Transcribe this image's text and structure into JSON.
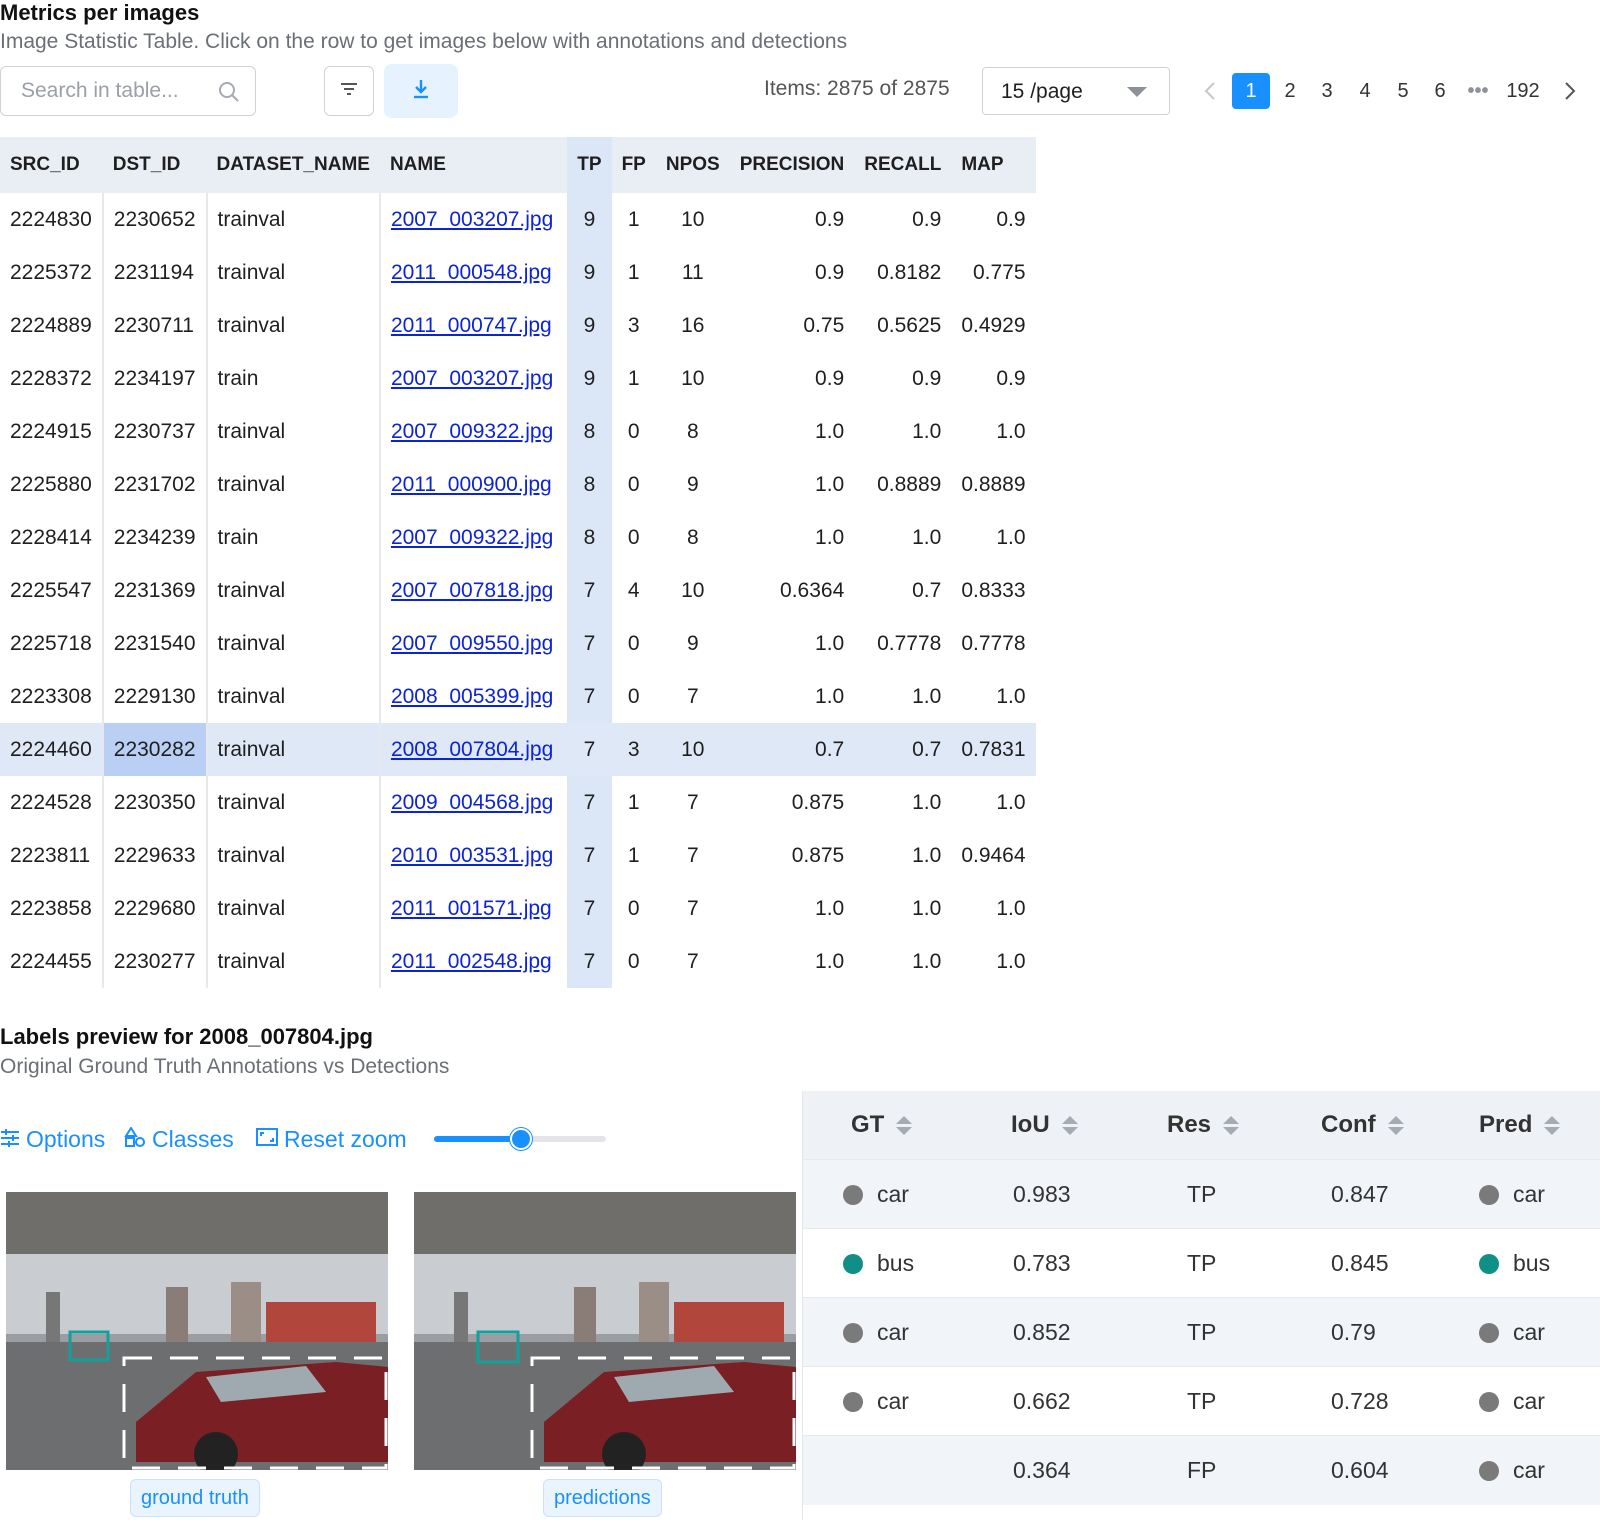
{
  "header": {
    "title": "Metrics per images",
    "subtitle": "Image Statistic Table. Click on the row to get images below with annotations and detections"
  },
  "toolbar": {
    "search_placeholder": "Search in table...",
    "items_text": "Items: 2875 of 2875",
    "page_size": "15 /page",
    "icons": [
      "search-icon",
      "filter-icon",
      "download-icon"
    ]
  },
  "pagination": {
    "pages": [
      "1",
      "2",
      "3",
      "4",
      "5",
      "6"
    ],
    "ellipsis": "•••",
    "last": "192",
    "active": "1"
  },
  "table": {
    "columns": [
      "SRC_ID",
      "DST_ID",
      "DATASET_NAME",
      "NAME",
      "TP",
      "FP",
      "NPOS",
      "PRECISION",
      "RECALL",
      "MAP"
    ],
    "selected_row": 10,
    "rows": [
      [
        "2224830",
        "2230652",
        "trainval",
        "2007_003207.jpg",
        "9",
        "1",
        "10",
        "0.9",
        "0.9",
        "0.9"
      ],
      [
        "2225372",
        "2231194",
        "trainval",
        "2011_000548.jpg",
        "9",
        "1",
        "11",
        "0.9",
        "0.8182",
        "0.775"
      ],
      [
        "2224889",
        "2230711",
        "trainval",
        "2011_000747.jpg",
        "9",
        "3",
        "16",
        "0.75",
        "0.5625",
        "0.4929"
      ],
      [
        "2228372",
        "2234197",
        "train",
        "2007_003207.jpg",
        "9",
        "1",
        "10",
        "0.9",
        "0.9",
        "0.9"
      ],
      [
        "2224915",
        "2230737",
        "trainval",
        "2007_009322.jpg",
        "8",
        "0",
        "8",
        "1.0",
        "1.0",
        "1.0"
      ],
      [
        "2225880",
        "2231702",
        "trainval",
        "2011_000900.jpg",
        "8",
        "0",
        "9",
        "1.0",
        "0.8889",
        "0.8889"
      ],
      [
        "2228414",
        "2234239",
        "train",
        "2007_009322.jpg",
        "8",
        "0",
        "8",
        "1.0",
        "1.0",
        "1.0"
      ],
      [
        "2225547",
        "2231369",
        "trainval",
        "2007_007818.jpg",
        "7",
        "4",
        "10",
        "0.6364",
        "0.7",
        "0.8333"
      ],
      [
        "2225718",
        "2231540",
        "trainval",
        "2007_009550.jpg",
        "7",
        "0",
        "9",
        "1.0",
        "0.7778",
        "0.7778"
      ],
      [
        "2223308",
        "2229130",
        "trainval",
        "2008_005399.jpg",
        "7",
        "0",
        "7",
        "1.0",
        "1.0",
        "1.0"
      ],
      [
        "2224460",
        "2230282",
        "trainval",
        "2008_007804.jpg",
        "7",
        "3",
        "10",
        "0.7",
        "0.7",
        "0.7831"
      ],
      [
        "2224528",
        "2230350",
        "trainval",
        "2009_004568.jpg",
        "7",
        "1",
        "7",
        "0.875",
        "1.0",
        "1.0"
      ],
      [
        "2223811",
        "2229633",
        "trainval",
        "2010_003531.jpg",
        "7",
        "1",
        "7",
        "0.875",
        "1.0",
        "0.9464"
      ],
      [
        "2223858",
        "2229680",
        "trainval",
        "2011_001571.jpg",
        "7",
        "0",
        "7",
        "1.0",
        "1.0",
        "1.0"
      ],
      [
        "2224455",
        "2230277",
        "trainval",
        "2011_002548.jpg",
        "7",
        "0",
        "7",
        "1.0",
        "1.0",
        "1.0"
      ]
    ]
  },
  "preview": {
    "title": "Labels preview for 2008_007804.jpg",
    "subtitle": "Original Ground Truth Annotations vs Detections",
    "options_label": "Options",
    "classes_label": "Classes",
    "reset_zoom_label": "Reset zoom",
    "zoom_level": 0.5,
    "gt_caption": "ground truth",
    "pred_caption": "predictions"
  },
  "match_table": {
    "columns": [
      "GT",
      "IoU",
      "Res",
      "Conf",
      "Pred"
    ],
    "rows": [
      {
        "gt": "car",
        "gt_color": "#7a7a7a",
        "iou": "0.983",
        "res": "TP",
        "conf": "0.847",
        "pred": "car",
        "pred_color": "#7a7a7a"
      },
      {
        "gt": "bus",
        "gt_color": "#0f8f86",
        "iou": "0.783",
        "res": "TP",
        "conf": "0.845",
        "pred": "bus",
        "pred_color": "#0f8f86"
      },
      {
        "gt": "car",
        "gt_color": "#7a7a7a",
        "iou": "0.852",
        "res": "TP",
        "conf": "0.79",
        "pred": "car",
        "pred_color": "#7a7a7a"
      },
      {
        "gt": "car",
        "gt_color": "#7a7a7a",
        "iou": "0.662",
        "res": "TP",
        "conf": "0.728",
        "pred": "car",
        "pred_color": "#7a7a7a"
      },
      {
        "gt": "",
        "gt_color": "",
        "iou": "0.364",
        "res": "FP",
        "conf": "0.604",
        "pred": "car",
        "pred_color": "#7a7a7a"
      }
    ]
  }
}
